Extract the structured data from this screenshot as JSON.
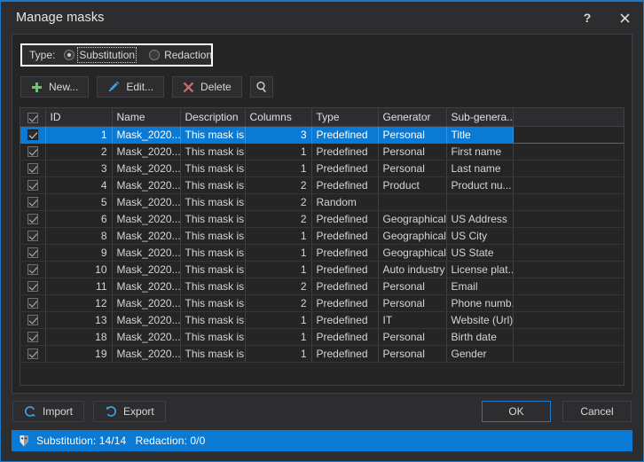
{
  "window": {
    "title": "Manage masks",
    "help_label": "?",
    "close_label": "×"
  },
  "type_group": {
    "label": "Type:",
    "options": [
      {
        "label": "Substitution",
        "selected": true
      },
      {
        "label": "Redaction",
        "selected": false
      }
    ]
  },
  "toolbar": {
    "new_label": "New...",
    "edit_label": "Edit...",
    "delete_label": "Delete",
    "search_label": ""
  },
  "table": {
    "headers": [
      "",
      "ID",
      "Name",
      "Description",
      "Columns",
      "Type",
      "Generator",
      "Sub-genera...",
      ""
    ],
    "rows": [
      {
        "checked": true,
        "selected": true,
        "id": "1",
        "name": "Mask_2020...",
        "description": "This mask is...",
        "columns": "3",
        "type": "Predefined",
        "generator": "Personal",
        "subgenerator": "Title"
      },
      {
        "checked": true,
        "selected": false,
        "id": "2",
        "name": "Mask_2020...",
        "description": "This mask is...",
        "columns": "1",
        "type": "Predefined",
        "generator": "Personal",
        "subgenerator": "First name"
      },
      {
        "checked": true,
        "selected": false,
        "id": "3",
        "name": "Mask_2020...",
        "description": "This mask is...",
        "columns": "1",
        "type": "Predefined",
        "generator": "Personal",
        "subgenerator": "Last name"
      },
      {
        "checked": true,
        "selected": false,
        "id": "4",
        "name": "Mask_2020...",
        "description": "This mask is...",
        "columns": "2",
        "type": "Predefined",
        "generator": "Product",
        "subgenerator": "Product nu..."
      },
      {
        "checked": true,
        "selected": false,
        "id": "5",
        "name": "Mask_2020...",
        "description": "This mask is...",
        "columns": "2",
        "type": "Random",
        "generator": "",
        "subgenerator": ""
      },
      {
        "checked": true,
        "selected": false,
        "id": "6",
        "name": "Mask_2020...",
        "description": "This mask is...",
        "columns": "2",
        "type": "Predefined",
        "generator": "Geographical",
        "subgenerator": "US Address"
      },
      {
        "checked": true,
        "selected": false,
        "id": "8",
        "name": "Mask_2020...",
        "description": "This mask is...",
        "columns": "1",
        "type": "Predefined",
        "generator": "Geographical",
        "subgenerator": "US City"
      },
      {
        "checked": true,
        "selected": false,
        "id": "9",
        "name": "Mask_2020...",
        "description": "This mask is...",
        "columns": "1",
        "type": "Predefined",
        "generator": "Geographical",
        "subgenerator": "US State"
      },
      {
        "checked": true,
        "selected": false,
        "id": "10",
        "name": "Mask_2020...",
        "description": "This mask is...",
        "columns": "1",
        "type": "Predefined",
        "generator": "Auto industry",
        "subgenerator": "License plat..."
      },
      {
        "checked": true,
        "selected": false,
        "id": "11",
        "name": "Mask_2020...",
        "description": "This mask is...",
        "columns": "2",
        "type": "Predefined",
        "generator": "Personal",
        "subgenerator": "Email"
      },
      {
        "checked": true,
        "selected": false,
        "id": "12",
        "name": "Mask_2020...",
        "description": "This mask is...",
        "columns": "2",
        "type": "Predefined",
        "generator": "Personal",
        "subgenerator": "Phone numb..."
      },
      {
        "checked": true,
        "selected": false,
        "id": "13",
        "name": "Mask_2020...",
        "description": "This mask is...",
        "columns": "1",
        "type": "Predefined",
        "generator": "IT",
        "subgenerator": "Website (Url)"
      },
      {
        "checked": true,
        "selected": false,
        "id": "18",
        "name": "Mask_2020...",
        "description": "This mask is...",
        "columns": "1",
        "type": "Predefined",
        "generator": "Personal",
        "subgenerator": "Birth date"
      },
      {
        "checked": true,
        "selected": false,
        "id": "19",
        "name": "Mask_2020...",
        "description": "This mask is...",
        "columns": "1",
        "type": "Predefined",
        "generator": "Personal",
        "subgenerator": "Gender"
      }
    ]
  },
  "footer": {
    "import_label": "Import",
    "export_label": "Export",
    "ok_label": "OK",
    "cancel_label": "Cancel"
  },
  "statusbar": {
    "text": "Substitution: 14/14   Redaction: 0/0"
  },
  "colors": {
    "accent": "#0a7ad4",
    "window_border": "#1b79c8",
    "background": "#2d2d30",
    "panel": "#252526",
    "border": "#3f3f46",
    "text": "#d8d8d8",
    "new_icon": "#6cc36c",
    "edit_icon": "#3d9ee0",
    "delete_icon": "#e06a63"
  }
}
